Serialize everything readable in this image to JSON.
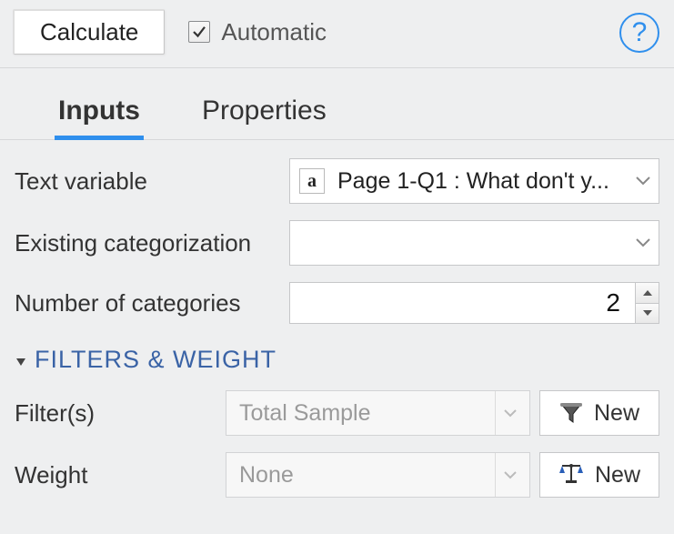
{
  "topbar": {
    "calc_label": "Calculate",
    "automatic_label": "Automatic",
    "automatic_checked": true
  },
  "tabs": {
    "inputs": "Inputs",
    "properties": "Properties"
  },
  "inputs": {
    "text_variable_label": "Text variable",
    "text_variable_value": "Page 1-Q1 : What don't y...",
    "existing_cat_label": "Existing categorization",
    "existing_cat_value": "",
    "num_categories_label": "Number of categories",
    "num_categories_value": "2"
  },
  "section_header": "FILTERS & WEIGHT",
  "filters": {
    "label": "Filter(s)",
    "value": "Total Sample",
    "new_label": "New"
  },
  "weight": {
    "label": "Weight",
    "value": "None",
    "new_label": "New"
  }
}
